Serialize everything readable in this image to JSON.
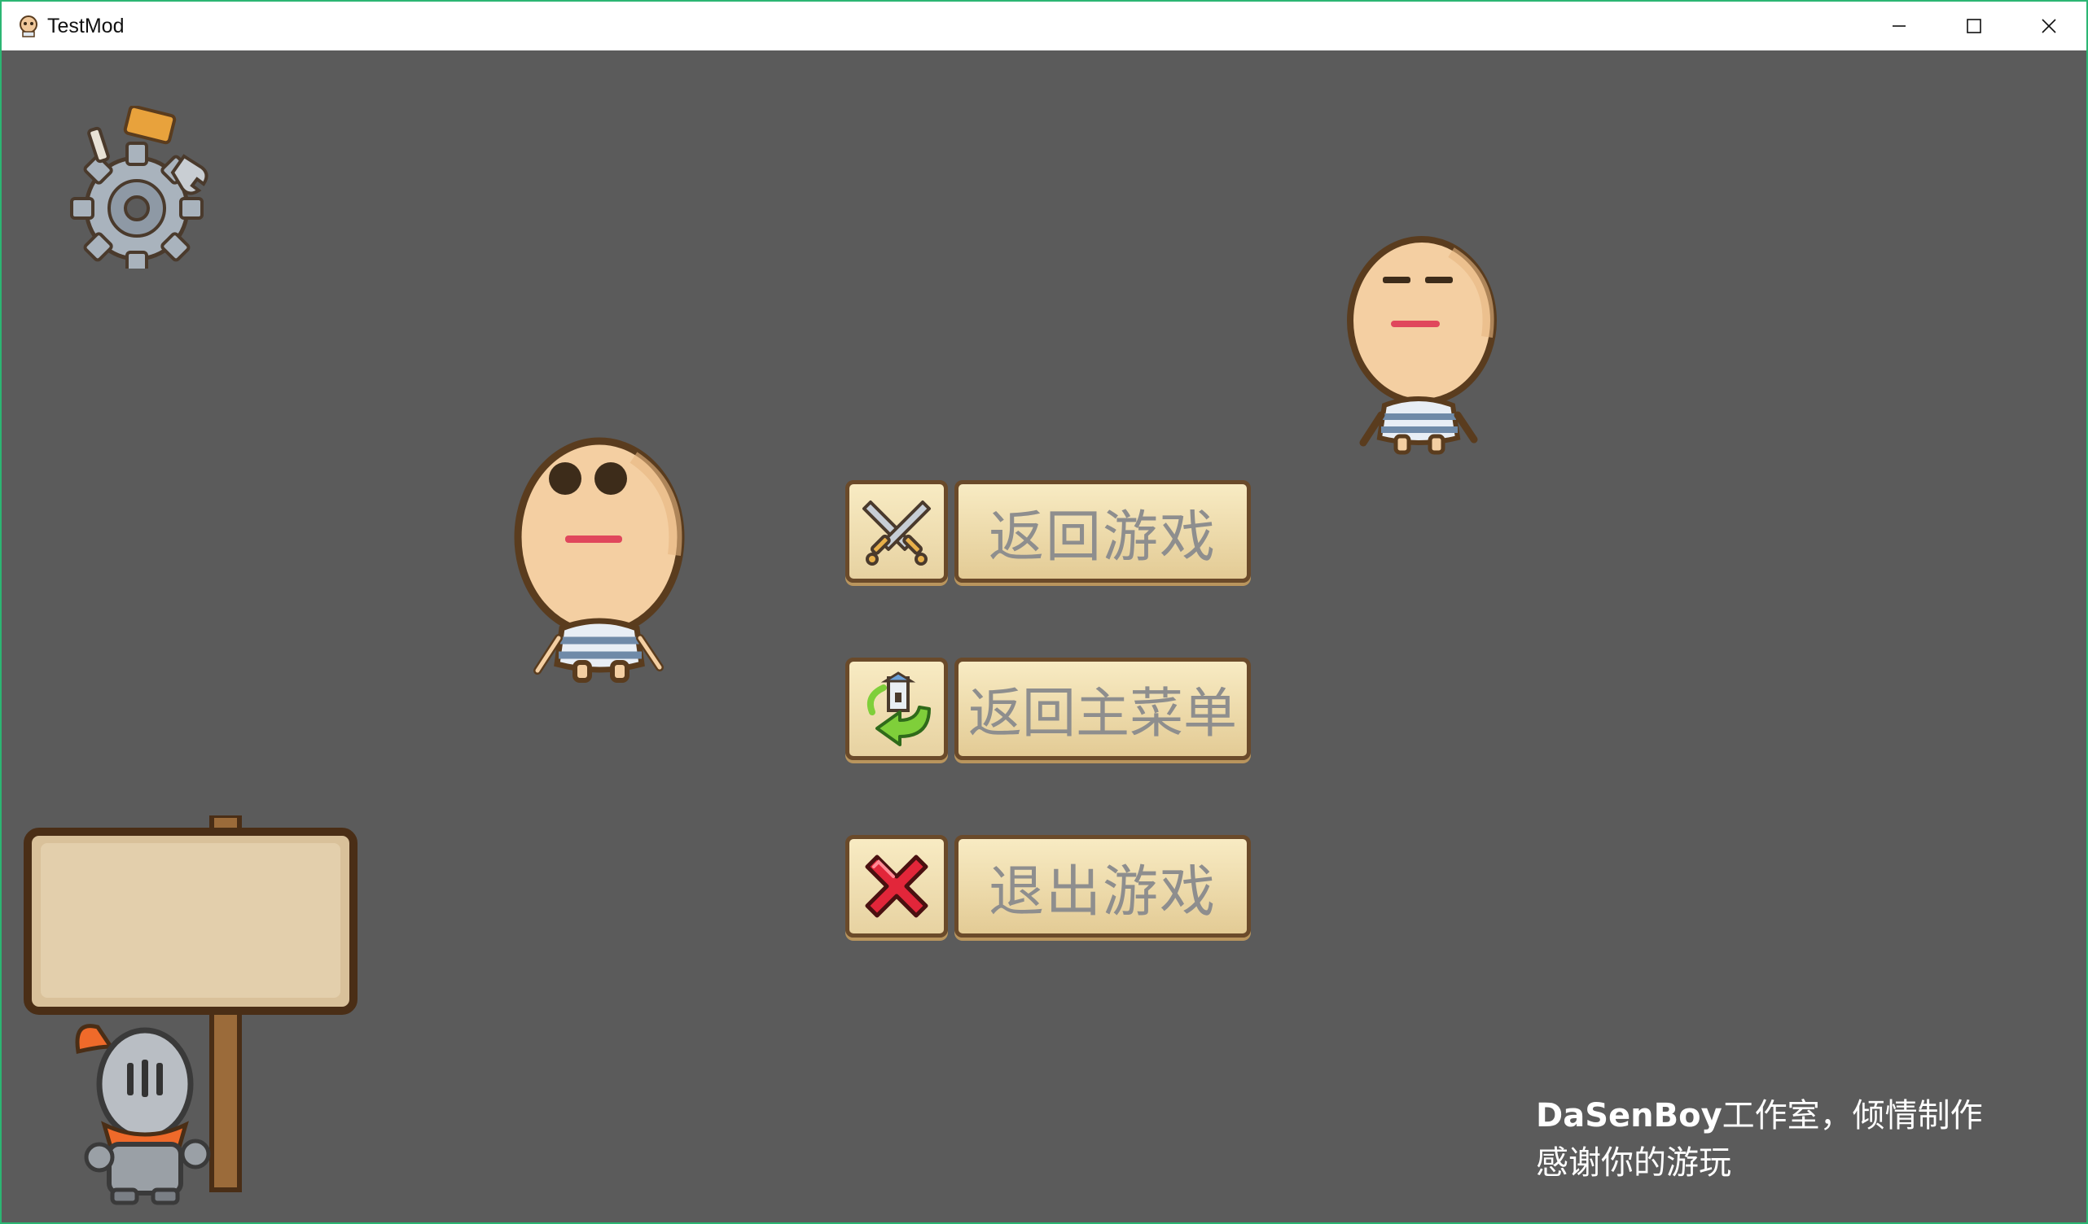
{
  "window": {
    "title": "TestMod",
    "controls": {
      "minimize": "minimize-icon",
      "maximize": "maximize-icon",
      "close": "close-icon"
    }
  },
  "menu": {
    "items": [
      {
        "label": "返回游戏",
        "icon": "crossed-swords-icon"
      },
      {
        "label": "返回主菜单",
        "icon": "return-home-icon"
      },
      {
        "label": "退出游戏",
        "icon": "red-x-icon"
      }
    ]
  },
  "credits": {
    "brand": "DaSenBoy",
    "line1_rest": "工作室，倾情制作",
    "line2": "感谢你的游玩"
  },
  "colors": {
    "background": "#5b5b5b",
    "window_border": "#2bb673",
    "button_face": "#f3e2b5",
    "button_border": "#6a4a2a",
    "button_text": "#8e8e8e"
  },
  "sprites": [
    "settings-gear-icon",
    "character-awake",
    "character-sleepy",
    "signpost-knight"
  ]
}
